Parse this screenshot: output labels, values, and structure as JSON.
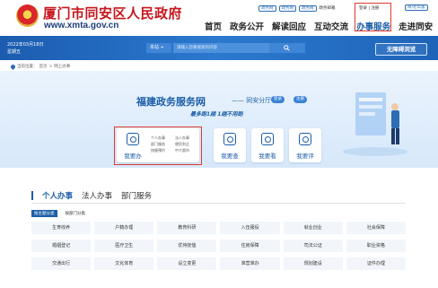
{
  "header": {
    "site_title": "厦门市同安区人民政府",
    "site_url": "www.xmta.gov.cn",
    "top_links": [
      "政务网",
      "政务网",
      "政务网"
    ],
    "mail_link": "政务邮箱",
    "login": "登录",
    "separator": "|",
    "register": "注册",
    "elder_mode": "简/老年版",
    "nav": [
      "首页",
      "政务公开",
      "解读回应",
      "互动交流",
      "办事服务",
      "走进同安"
    ]
  },
  "bluebar": {
    "date": "2022年03月18日",
    "weekday": "星期五",
    "scope": "本站 ÷",
    "search_placeholder": "请输入您要搜索的内容",
    "barrier_free": "无障碍浏览"
  },
  "breadcrumb": [
    "当前位置：",
    "首页",
    ">",
    "网上办事"
  ],
  "banner": {
    "title": "福建政务服务网",
    "subtitle": "—— 同安分厅",
    "login_pill": "登录",
    "register_pill": "注册",
    "slogan": "最多跑1趟   1趟不用跑",
    "service_main": {
      "label": "我要办",
      "mini": [
        "个人办事",
        "法人办事",
        "部门服务",
        "便民利企",
        "快捷预约",
        "中介超市"
      ]
    },
    "services": [
      {
        "label": "我要查"
      },
      {
        "label": "我要看"
      },
      {
        "label": "我要评"
      }
    ]
  },
  "tabs": [
    "个人办事",
    "法人办事",
    "部门服务"
  ],
  "subtabs": [
    "按主题分类",
    "按部门分类"
  ],
  "grid_items": [
    "生育收养",
    "户籍办理",
    "教育科研",
    "入伍服役",
    "就业创业",
    "社会保障",
    "婚姻登记",
    "医疗卫生",
    "优待抚恤",
    "住房保障",
    "司法公证",
    "职业资格",
    "交通出行",
    "文化体育",
    "设立变更",
    "准营准办",
    "规划建设",
    "证件办理"
  ],
  "colors": {
    "primary": "#1b5ea8",
    "brand_red": "#c8161d",
    "highlight": "#e03a2e"
  }
}
